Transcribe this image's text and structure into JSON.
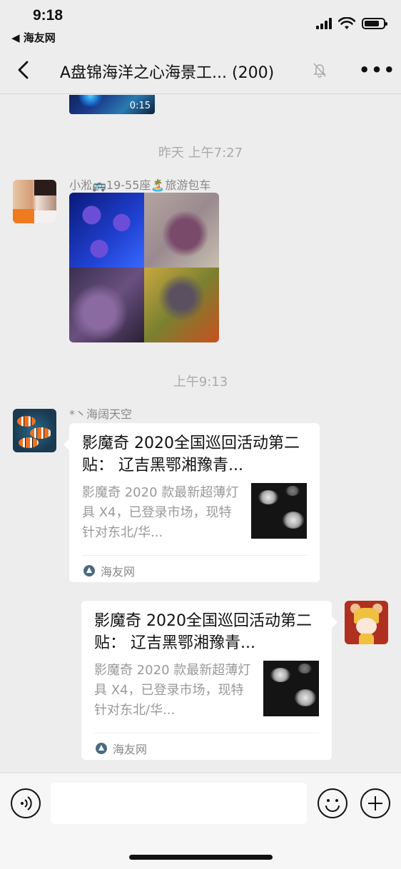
{
  "status_bar": {
    "time": "9:18",
    "back_app": "◀ 海友网"
  },
  "nav": {
    "title": "A盘锦海洋之心海景工... (200)",
    "more": "•••"
  },
  "chat": {
    "video_duration": "0:15",
    "time_1": "昨天 上午7:27",
    "msg1_sender": "小淞🚌19-55座🏝️旅游包车",
    "time_2": "上午9:13",
    "msg2_sender": "*丶海阔天空",
    "card_title": "影魔奇 2020全国巡回活动第二贴： 辽吉黑鄂湘豫青...",
    "card_desc": "影魔奇 2020 款最新超薄灯具 X4，已登录市场，现特针对东北/华...",
    "card_source": "海友网"
  },
  "colors": {
    "background": "#ededed",
    "card": "#ffffff",
    "timestamp": "#aaaaaa"
  }
}
